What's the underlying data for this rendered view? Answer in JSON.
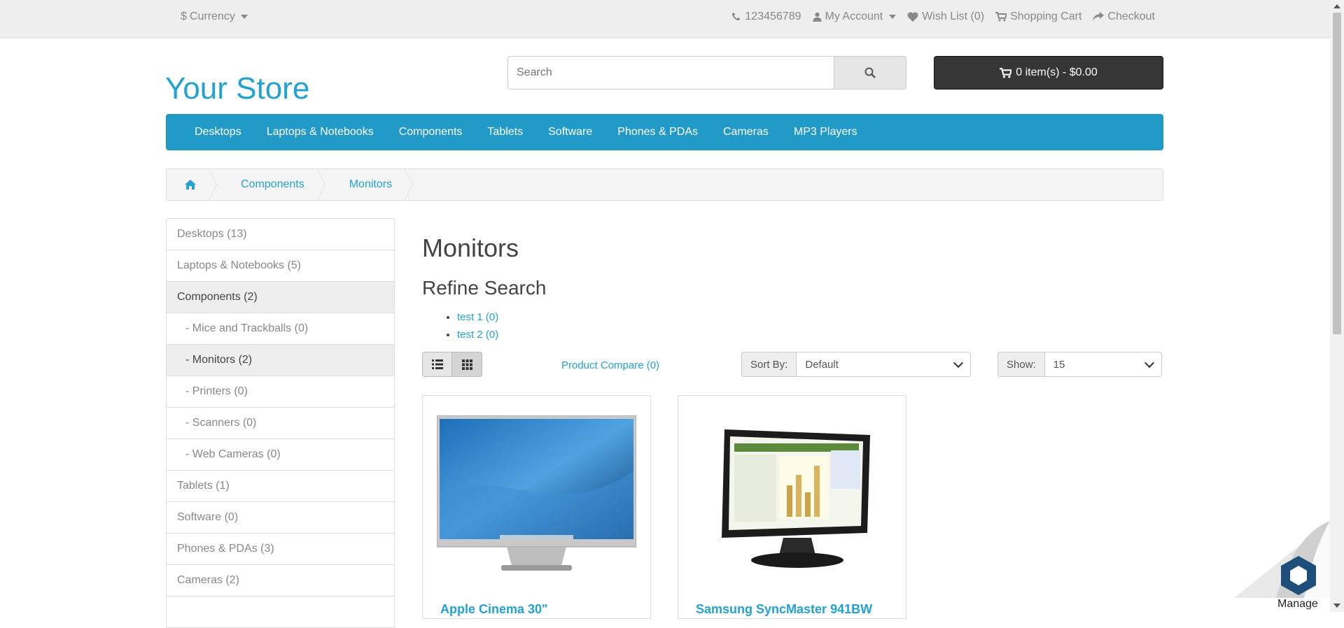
{
  "topbar": {
    "currency_symbol": "$",
    "currency_label": "Currency",
    "phone": "123456789",
    "my_account": "My Account",
    "wishlist": "Wish List (0)",
    "shopping_cart": "Shopping Cart",
    "checkout": "Checkout"
  },
  "header": {
    "logo": "Your Store",
    "search_placeholder": "Search",
    "cart_label": "0 item(s) - $0.00"
  },
  "menu": {
    "items": [
      "Desktops",
      "Laptops & Notebooks",
      "Components",
      "Tablets",
      "Software",
      "Phones & PDAs",
      "Cameras",
      "MP3 Players"
    ]
  },
  "breadcrumb": {
    "items": [
      "Components",
      "Monitors"
    ]
  },
  "sidebar": {
    "items": [
      {
        "label": "Desktops (13)"
      },
      {
        "label": "Laptops & Notebooks (5)"
      },
      {
        "label": "Components (2)"
      },
      {
        "label": "- Mice and Trackballs (0)"
      },
      {
        "label": "- Monitors (2)"
      },
      {
        "label": "- Printers (0)"
      },
      {
        "label": "- Scanners (0)"
      },
      {
        "label": "- Web Cameras (0)"
      },
      {
        "label": "Tablets (1)"
      },
      {
        "label": "Software (0)"
      },
      {
        "label": "Phones & PDAs (3)"
      },
      {
        "label": "Cameras (2)"
      }
    ]
  },
  "main": {
    "title": "Monitors",
    "refine_title": "Refine Search",
    "refine_items": [
      "test 1 (0)",
      "test 2 (0)"
    ],
    "compare": "Product Compare (0)",
    "sort_label": "Sort By:",
    "sort_value": "Default",
    "show_label": "Show:",
    "show_value": "15"
  },
  "products": [
    {
      "name": "Apple Cinema 30\""
    },
    {
      "name": "Samsung SyncMaster 941BW"
    }
  ],
  "widget": {
    "label": "Manage"
  },
  "colors": {
    "accent": "#229ac8",
    "link": "#23a1d1",
    "cart_bg": "#363636"
  }
}
